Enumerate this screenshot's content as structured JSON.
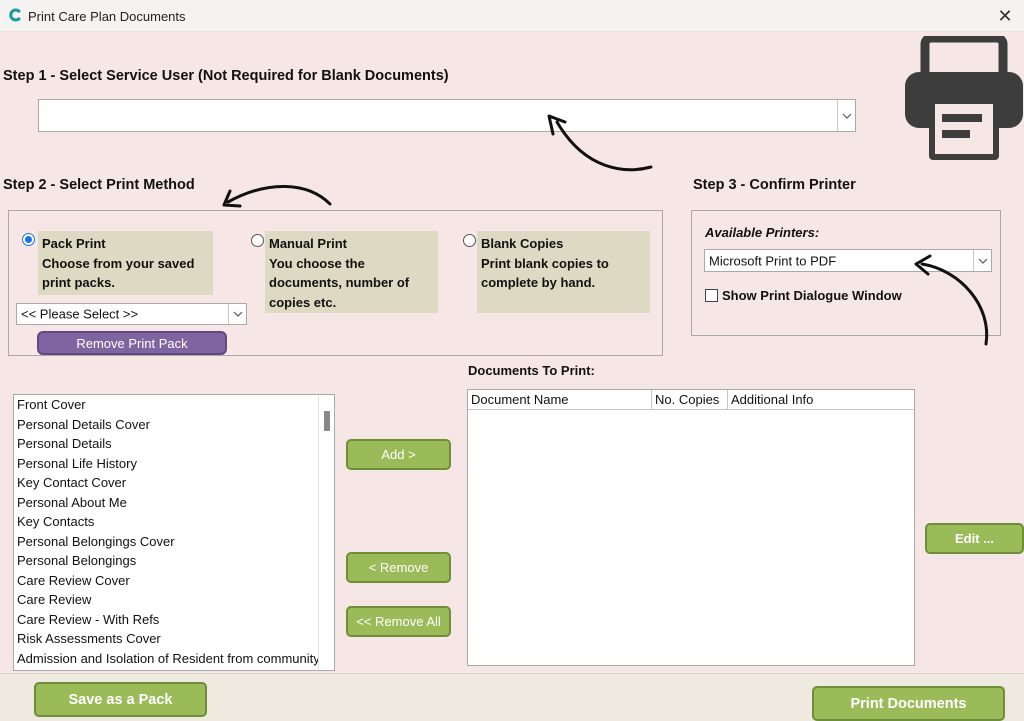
{
  "window": {
    "title": "Print Care Plan Documents"
  },
  "step1": {
    "title": "Step 1 - Select Service User (Not Required for Blank Documents)",
    "selected_value": ""
  },
  "step2": {
    "title": "Step 2 - Select Print Method",
    "options": [
      {
        "heading": "Pack Print",
        "lines": [
          "Choose from your saved",
          "print packs."
        ],
        "checked": true
      },
      {
        "heading": "Manual Print",
        "lines": [
          "You choose the",
          "documents, number of",
          "copies etc."
        ],
        "checked": false
      },
      {
        "heading": "Blank Copies",
        "lines": [
          "Print blank copies to",
          "complete by hand."
        ],
        "checked": false
      }
    ],
    "pack_select_value": "<< Please Select >>",
    "remove_pack_label": "Remove Print Pack"
  },
  "step3": {
    "title": "Step 3 - Confirm Printer",
    "available_printers_label": "Available Printers:",
    "printer_value": "Microsoft Print to PDF",
    "show_dialogue_label": "Show Print Dialogue Window",
    "show_dialogue_checked": false
  },
  "available_documents": [
    "Front Cover",
    "Personal Details Cover",
    "Personal Details",
    "Personal Life History",
    "Key Contact Cover",
    "Personal About Me",
    "Key Contacts",
    "Personal Belongings Cover",
    "Personal Belongings",
    "Care Review Cover",
    "Care Review",
    "Care Review - With Refs",
    "Risk Assessments Cover",
    "Admission and Isolation of Resident from community"
  ],
  "transfer_buttons": {
    "add": "Add >",
    "remove": "< Remove",
    "remove_all": "<< Remove All"
  },
  "documents_to_print": {
    "label": "Documents To Print:",
    "columns": [
      "Document Name",
      "No. Copies",
      "Additional Info"
    ],
    "rows": []
  },
  "edit_button": "Edit ...",
  "footer": {
    "save_pack": "Save as a Pack",
    "print_documents": "Print Documents"
  },
  "icons": {
    "app": "app-logo-icon",
    "printer": "printer-icon",
    "close": "close-icon",
    "dropdown": "chevron-down-icon"
  },
  "colors": {
    "background": "#f7e6e6",
    "option_box": "#ddd9c3",
    "green_button": "#9bbb59",
    "purple_button": "#8064a2",
    "footer": "#eeeae0",
    "radio_checked": "#1a73e8"
  }
}
